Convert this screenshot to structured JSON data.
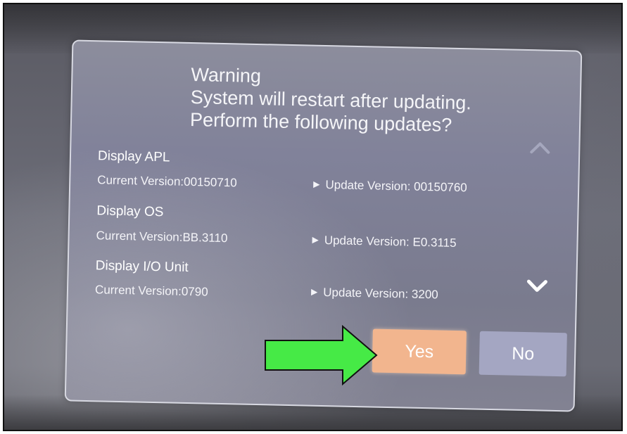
{
  "dialog": {
    "heading_lines": [
      "Warning",
      "System will restart after updating.",
      "Perform the following updates?"
    ],
    "entries": [
      {
        "title": "Display APL",
        "current": "Current Version:00150710",
        "update": "Update Version: 00150760"
      },
      {
        "title": "Display OS",
        "current": "Current Version:BB.3110",
        "update": "Update Version: E0.3115"
      },
      {
        "title": "Display I/O Unit",
        "current": "Current Version:0790",
        "update": "Update Version: 3200"
      }
    ],
    "yes_label": "Yes",
    "no_label": "No"
  },
  "icons": {
    "scroll_up": "chevron-up-icon",
    "scroll_down": "chevron-down-icon",
    "update_marker": "play-triangle-icon",
    "pointer": "green-arrow-icon"
  },
  "colors": {
    "yes_button": "#f2b58e",
    "no_button": "#a4a6c2",
    "dialog_background": "#818296",
    "arrow_fill": "#46ea46"
  }
}
